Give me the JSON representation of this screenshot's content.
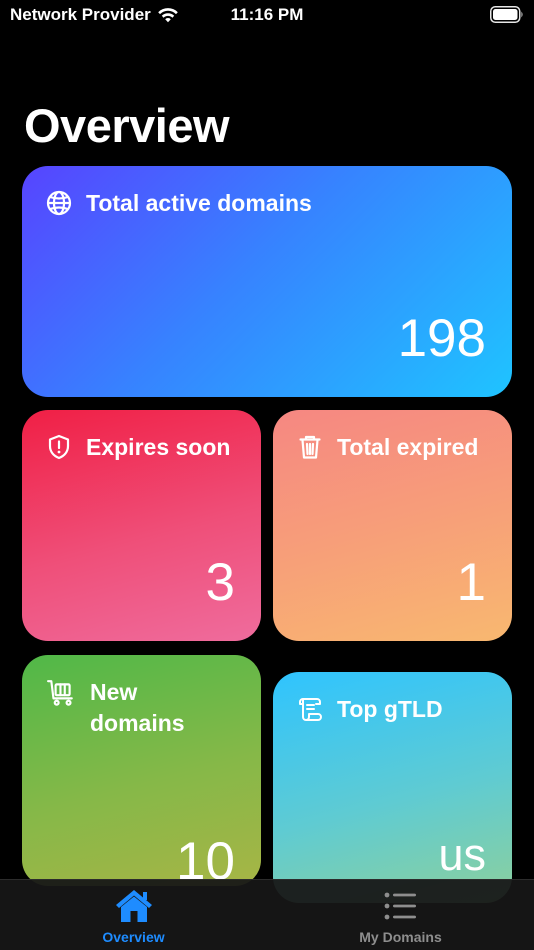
{
  "status_bar": {
    "carrier": "Network Provider",
    "time": "11:16 PM"
  },
  "page": {
    "title": "Overview"
  },
  "cards": {
    "total_active": {
      "label": "Total active domains",
      "value": "198",
      "icon": "globe-icon"
    },
    "expires_soon": {
      "label": "Expires soon",
      "value": "3",
      "icon": "shield-alert-icon"
    },
    "total_expired": {
      "label": "Total expired",
      "value": "1",
      "icon": "trash-icon"
    },
    "new_domains": {
      "label": "New\ndomains",
      "value": "10",
      "icon": "cart-icon"
    },
    "top_gtld": {
      "label": "Top gTLD",
      "value": "us",
      "icon": "scroll-icon"
    }
  },
  "tab_bar": {
    "tabs": [
      {
        "label": "Overview",
        "icon": "house-icon",
        "selected": true
      },
      {
        "label": "My Domains",
        "icon": "list-icon",
        "selected": false
      }
    ]
  },
  "colors": {
    "accent": "#1e8cff",
    "inactive_tab": "#8e8e8e",
    "background": "#000000"
  }
}
